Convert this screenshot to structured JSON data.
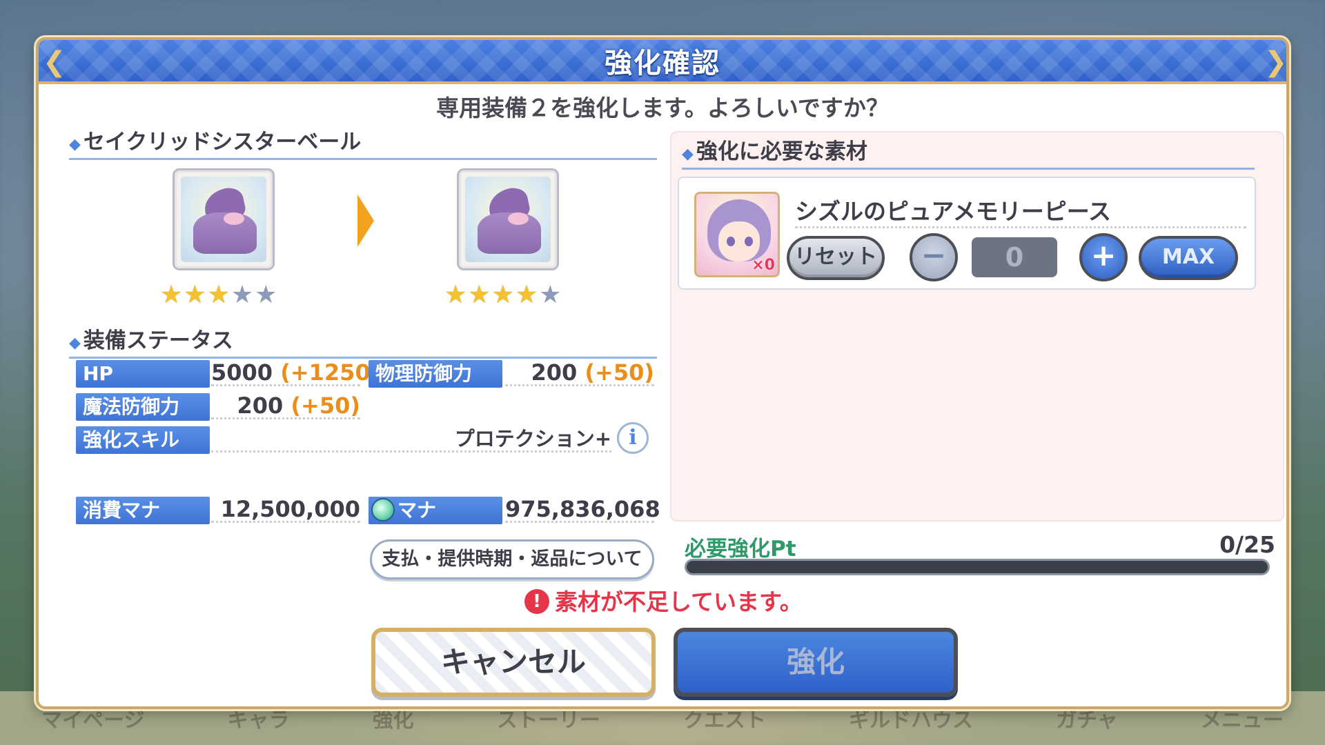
{
  "background_nav": [
    "マイページ",
    "キャラ",
    "強化",
    "ストーリー",
    "クエスト",
    "ギルドハウス",
    "ガチャ",
    "メニュー"
  ],
  "dialog": {
    "title": "強化確認",
    "subtitle": "専用装備２を強化します。よろしいですか？"
  },
  "equipment": {
    "name": "セイクリッドシスターベール",
    "before_stars": 3,
    "after_stars": 4,
    "max_stars": 5
  },
  "status": {
    "header": "装備ステータス",
    "hp_label": "HP",
    "hp_value": "5000",
    "hp_plus": "(+1250)",
    "phys_def_label": "物理防御力",
    "phys_def_value": "200",
    "phys_def_plus": "(+50)",
    "mag_def_label": "魔法防御力",
    "mag_def_value": "200",
    "mag_def_plus": "(+50)",
    "skill_label": "強化スキル",
    "skill_value": "プロテクション+",
    "info_glyph": "i"
  },
  "mana": {
    "cost_label": "消費マナ",
    "cost_value": "12,500,000",
    "owned_label": "マナ",
    "owned_value": "975,836,068",
    "payment_button": "支払・提供時期・返品について"
  },
  "materials": {
    "header": "強化に必要な素材",
    "item_name": "シズルのピュアメモリーピース",
    "owned_count": "×0",
    "reset_label": "リセット",
    "minus_label": "−",
    "quantity": "0",
    "plus_label": "+",
    "max_label": "MAX"
  },
  "points": {
    "label": "必要強化Pt",
    "value": "0/25",
    "progress": 0
  },
  "warning": {
    "icon": "!",
    "text": "素材が不足しています。"
  },
  "buttons": {
    "cancel": "キャンセル",
    "confirm": "強化"
  }
}
